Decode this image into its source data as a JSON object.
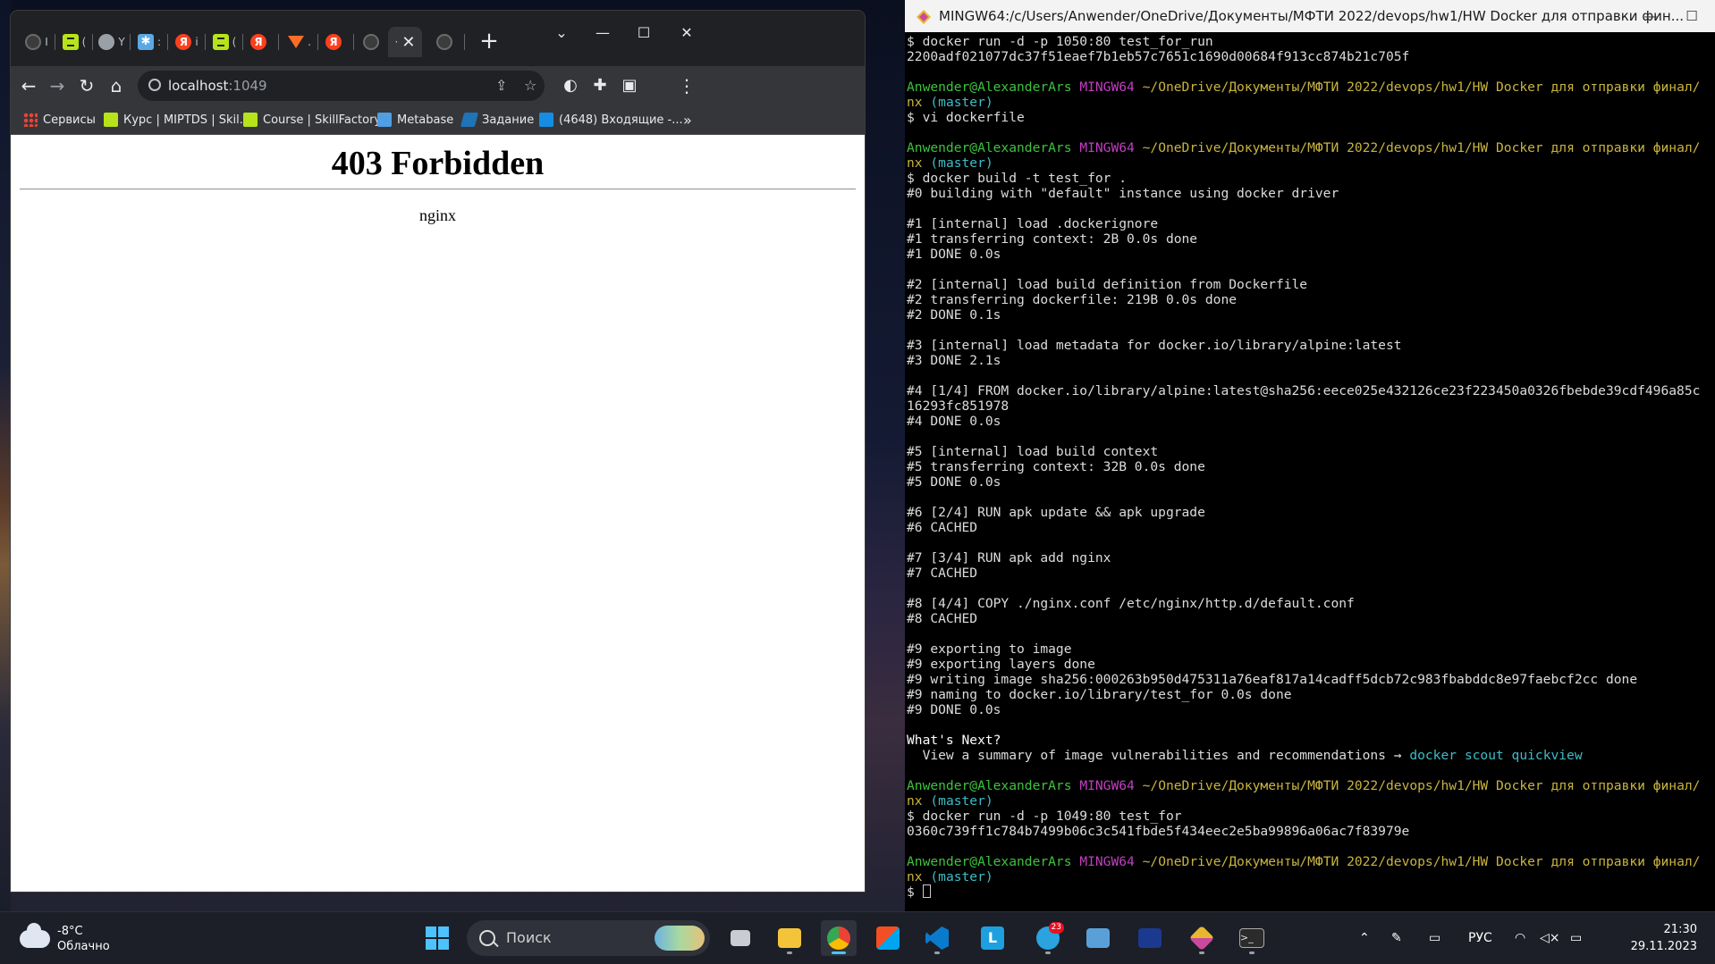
{
  "chrome": {
    "tabs": [
      {
        "icon": "github-icon",
        "label": "I"
      },
      {
        "icon": "skillfactory-icon",
        "label": "("
      },
      {
        "icon": "globe-icon",
        "label": "Y"
      },
      {
        "icon": "snowflake-icon",
        "label": ":"
      },
      {
        "icon": "yandex-icon",
        "label": "i"
      },
      {
        "icon": "skillfactory-icon",
        "label": "("
      },
      {
        "icon": "yandex-icon",
        "label": ""
      },
      {
        "icon": "gitlab-icon",
        "label": "."
      },
      {
        "icon": "yandex-icon",
        "label": ""
      },
      {
        "icon": "github-icon",
        "label": ""
      },
      {
        "icon": "",
        "label": "·",
        "close": "✕"
      },
      {
        "icon": "github-icon",
        "label": ""
      }
    ],
    "new_tab": "+",
    "url_host": "localhost",
    "url_port": ":1049",
    "bookmarks": [
      {
        "icon": "apps-grid-icon",
        "label": "Сервисы"
      },
      {
        "icon": "skillfactory-icon",
        "label": "Курс | MIPTDS | Skil..."
      },
      {
        "icon": "skillfactory-icon",
        "label": "Course | SkillFactory"
      },
      {
        "icon": "metabase-icon",
        "label": "Metabase"
      },
      {
        "icon": "zendesk-icon",
        "label": "Задание"
      },
      {
        "icon": "mail-icon",
        "label": "(4648) Входящие -..."
      }
    ],
    "bookmarks_more": "»",
    "page": {
      "heading": "403 Forbidden",
      "server": "nginx"
    }
  },
  "terminal": {
    "title": "MINGW64:/c/Users/Anwender/OneDrive/Документы/МФТИ 2022/devops/hw1/HW Docker для отправки фин...",
    "prompt": {
      "user": "Anwender@AlexanderArs",
      "env": "MINGW64",
      "path": "~/OneDrive/Документы/МФТИ 2022/devops/hw1/HW Docker для отправки финал/",
      "path_cont": "nx",
      "branch": "(master)"
    },
    "lines": [
      {
        "t": "plain",
        "text": "$ docker run -d -p 1050:80 test_for_run"
      },
      {
        "t": "plain",
        "text": "2200adf021077dc37f51eaef7b1eb57c7651c1690d00684f913cc874b21c705f"
      },
      {
        "t": "blank",
        "text": ""
      },
      {
        "t": "prompt",
        "text": ""
      },
      {
        "t": "prompt2",
        "text": ""
      },
      {
        "t": "plain",
        "text": "$ vi dockerfile"
      },
      {
        "t": "blank",
        "text": ""
      },
      {
        "t": "prompt",
        "text": ""
      },
      {
        "t": "prompt2",
        "text": ""
      },
      {
        "t": "plain",
        "text": "$ docker build -t test_for ."
      },
      {
        "t": "plain",
        "text": "#0 building with \"default\" instance using docker driver"
      },
      {
        "t": "blank",
        "text": ""
      },
      {
        "t": "plain",
        "text": "#1 [internal] load .dockerignore"
      },
      {
        "t": "plain",
        "text": "#1 transferring context: 2B 0.0s done"
      },
      {
        "t": "plain",
        "text": "#1 DONE 0.0s"
      },
      {
        "t": "blank",
        "text": ""
      },
      {
        "t": "plain",
        "text": "#2 [internal] load build definition from Dockerfile"
      },
      {
        "t": "plain",
        "text": "#2 transferring dockerfile: 219B 0.0s done"
      },
      {
        "t": "plain",
        "text": "#2 DONE 0.1s"
      },
      {
        "t": "blank",
        "text": ""
      },
      {
        "t": "plain",
        "text": "#3 [internal] load metadata for docker.io/library/alpine:latest"
      },
      {
        "t": "plain",
        "text": "#3 DONE 2.1s"
      },
      {
        "t": "blank",
        "text": ""
      },
      {
        "t": "plain",
        "text": "#4 [1/4] FROM docker.io/library/alpine:latest@sha256:eece025e432126ce23f223450a0326fbebde39cdf496a85c"
      },
      {
        "t": "plain",
        "text": "16293fc851978"
      },
      {
        "t": "plain",
        "text": "#4 DONE 0.0s"
      },
      {
        "t": "blank",
        "text": ""
      },
      {
        "t": "plain",
        "text": "#5 [internal] load build context"
      },
      {
        "t": "plain",
        "text": "#5 transferring context: 32B 0.0s done"
      },
      {
        "t": "plain",
        "text": "#5 DONE 0.0s"
      },
      {
        "t": "blank",
        "text": ""
      },
      {
        "t": "plain",
        "text": "#6 [2/4] RUN apk update && apk upgrade"
      },
      {
        "t": "plain",
        "text": "#6 CACHED"
      },
      {
        "t": "blank",
        "text": ""
      },
      {
        "t": "plain",
        "text": "#7 [3/4] RUN apk add nginx"
      },
      {
        "t": "plain",
        "text": "#7 CACHED"
      },
      {
        "t": "blank",
        "text": ""
      },
      {
        "t": "plain",
        "text": "#8 [4/4] COPY ./nginx.conf /etc/nginx/http.d/default.conf"
      },
      {
        "t": "plain",
        "text": "#8 CACHED"
      },
      {
        "t": "blank",
        "text": ""
      },
      {
        "t": "plain",
        "text": "#9 exporting to image"
      },
      {
        "t": "plain",
        "text": "#9 exporting layers done"
      },
      {
        "t": "plain",
        "text": "#9 writing image sha256:000263b950d475311a76eaf817a14cadff5dcb72c983fbabddc8e97faebcf2cc done"
      },
      {
        "t": "plain",
        "text": "#9 naming to docker.io/library/test_for 0.0s done"
      },
      {
        "t": "plain",
        "text": "#9 DONE 0.0s"
      },
      {
        "t": "blank",
        "text": ""
      },
      {
        "t": "white",
        "text": "What's Next?"
      },
      {
        "t": "next",
        "text": "  View a summary of image vulnerabilities and recommendations → ",
        "link": "docker scout quickview"
      },
      {
        "t": "blank",
        "text": ""
      },
      {
        "t": "prompt",
        "text": ""
      },
      {
        "t": "prompt2",
        "text": ""
      },
      {
        "t": "plain",
        "text": "$ docker run -d -p 1049:80 test_for"
      },
      {
        "t": "plain",
        "text": "0360c739ff1c784b7499b06c3c541fbde5f434eec2e5ba99896a06ac7f83979e"
      },
      {
        "t": "blank",
        "text": ""
      },
      {
        "t": "prompt",
        "text": ""
      },
      {
        "t": "prompt2",
        "text": ""
      },
      {
        "t": "cursor",
        "text": "$ "
      }
    ]
  },
  "taskbar": {
    "weather_temp": "-8°C",
    "weather_desc": "Облачно",
    "search_label": "Поиск",
    "telegram_badge": "23",
    "lang": "РУС",
    "time": "21:30",
    "date": "29.11.2023"
  }
}
